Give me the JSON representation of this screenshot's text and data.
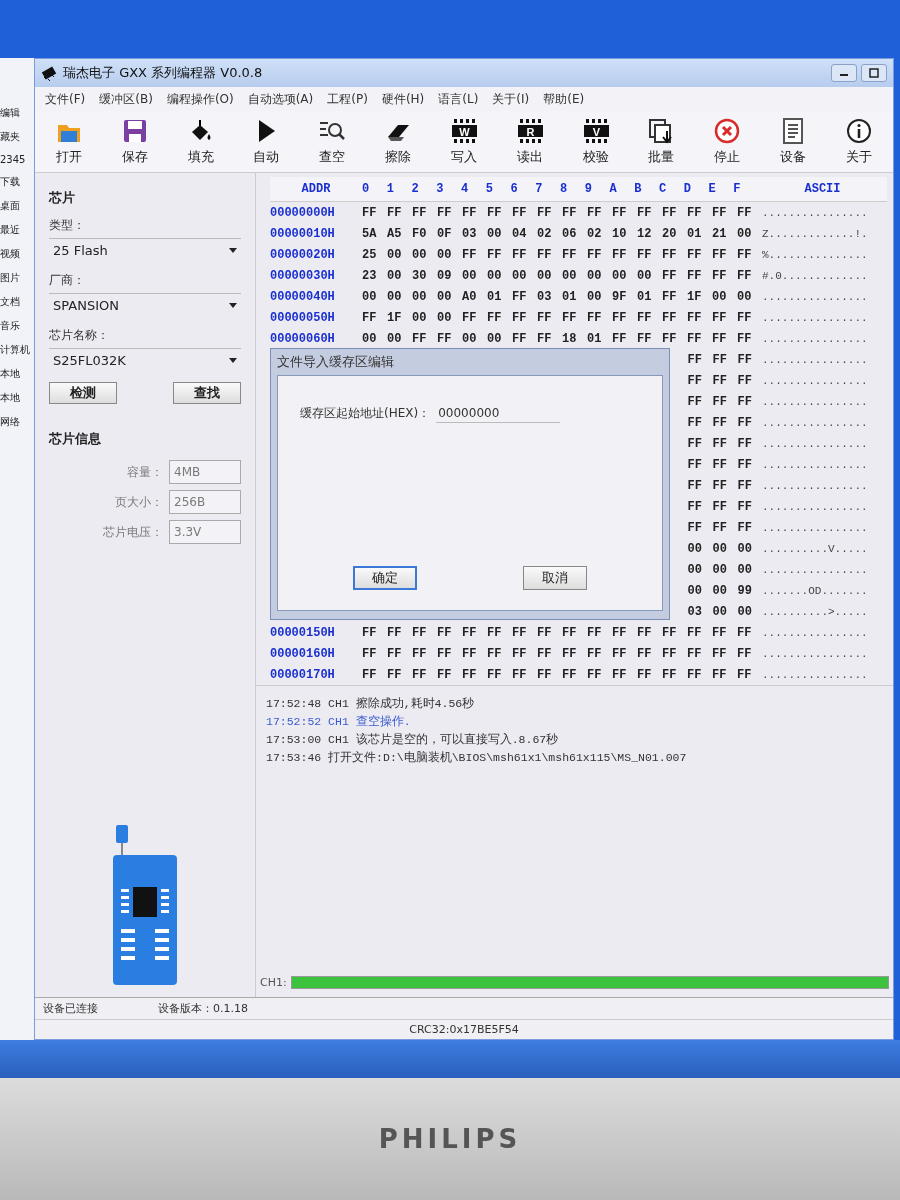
{
  "explorer": {
    "items": [
      "编辑",
      "藏夹",
      "2345",
      "下载",
      "桌面",
      "最近",
      "视频",
      "图片",
      "文档",
      "音乐",
      "计算机",
      "本地",
      "本地",
      "网络"
    ]
  },
  "window": {
    "title": "瑞杰电子 GXX 系列编程器 V0.0.8"
  },
  "menu": [
    "文件(F)",
    "缓冲区(B)",
    "编程操作(O)",
    "自动选项(A)",
    "工程(P)",
    "硬件(H)",
    "语言(L)",
    "关于(I)",
    "帮助(E)"
  ],
  "toolbar": [
    {
      "label": "打开",
      "kind": "folder"
    },
    {
      "label": "保存",
      "kind": "disk"
    },
    {
      "label": "填充",
      "kind": "bucket"
    },
    {
      "label": "自动",
      "kind": "play"
    },
    {
      "label": "查空",
      "kind": "search"
    },
    {
      "label": "擦除",
      "kind": "eraser"
    },
    {
      "label": "写入",
      "kind": "chip",
      "glyph": "W"
    },
    {
      "label": "读出",
      "kind": "chip",
      "glyph": "R"
    },
    {
      "label": "校验",
      "kind": "chip",
      "glyph": "V"
    },
    {
      "label": "批量",
      "kind": "copy"
    },
    {
      "label": "停止",
      "kind": "stop"
    },
    {
      "label": "设备",
      "kind": "document"
    },
    {
      "label": "关于",
      "kind": "info"
    }
  ],
  "chip_panel": {
    "heading": "芯片",
    "selects": [
      {
        "label": "类型：",
        "value": "25 Flash"
      },
      {
        "label": "厂商：",
        "value": "SPANSION"
      },
      {
        "label": "芯片名称：",
        "value": "S25FL032K"
      }
    ],
    "buttons": [
      "检测",
      "查找"
    ],
    "info_heading": "芯片信息",
    "info": [
      {
        "label": "容量：",
        "value": "4MB",
        "disabled": true
      },
      {
        "label": "页大小：",
        "value": "256B",
        "disabled": true
      },
      {
        "label": "芯片电压：",
        "value": "3.3V",
        "disabled": true
      }
    ]
  },
  "hex_view": {
    "addr_heading": "ADDR",
    "columns": [
      "0",
      "1",
      "2",
      "3",
      "4",
      "5",
      "6",
      "7",
      "8",
      "9",
      "A",
      "B",
      "C",
      "D",
      "E",
      "F"
    ],
    "ascii_heading": "ASCII",
    "rows": [
      {
        "address": "00000000H",
        "bytes": "FF FF FF FF FF FF FF FF FF FF FF FF FF FF FF FF",
        "ascii": "................"
      },
      {
        "address": "00000010H",
        "bytes": "5A A5 F0 0F 03 00 04 02 06 02 10 12 20 01 21 00",
        "ascii": "Z.............!."
      },
      {
        "address": "00000020H",
        "bytes": "25 00 00 00 FF FF FF FF FF FF FF FF FF FF FF FF",
        "ascii": "%..............."
      },
      {
        "address": "00000030H",
        "bytes": "23 00 30 09 00 00 00 00 00 00 00 00 FF FF FF FF",
        "ascii": "#.0............."
      },
      {
        "address": "00000040H",
        "bytes": "00 00 00 00 A0 01 FF 03 01 00 9F 01 FF 1F 00 00",
        "ascii": "................"
      },
      {
        "address": "00000050H",
        "bytes": "FF 1F 00 00 FF FF FF FF FF FF FF FF FF FF FF FF",
        "ascii": "................"
      },
      {
        "address": "00000060H",
        "bytes": "00 00 FF FF 00 00 FF FF 18 01 FF FF FF FF FF FF",
        "ascii": "................"
      },
      {
        "bytes": "FF FF FF",
        "ascii": "................"
      },
      {
        "bytes": "FF FF FF",
        "ascii": "................"
      },
      {
        "bytes": "FF FF FF",
        "ascii": "................"
      },
      {
        "bytes": "FF FF FF",
        "ascii": "................"
      },
      {
        "bytes": "FF FF FF",
        "ascii": "................"
      },
      {
        "bytes": "FF FF FF",
        "ascii": "................"
      },
      {
        "bytes": "FF FF FF",
        "ascii": "................"
      },
      {
        "bytes": "FF FF FF",
        "ascii": "................"
      },
      {
        "bytes": "FF FF FF",
        "ascii": "................"
      },
      {
        "bytes": "00 00 00",
        "ascii": "..........V....."
      },
      {
        "bytes": "00 00 00",
        "ascii": "................"
      },
      {
        "bytes": "00 00 99",
        "ascii": ".......OD......."
      },
      {
        "bytes": "03 00 00",
        "ascii": "..........>....."
      },
      {
        "address": "00000150H",
        "bytes": "FF FF FF FF FF FF FF FF FF FF FF FF FF FF FF FF",
        "ascii": "................"
      },
      {
        "address": "00000160H",
        "bytes": "FF FF FF FF FF FF FF FF FF FF FF FF FF FF FF FF",
        "ascii": "................"
      },
      {
        "address": "00000170H",
        "bytes": "FF FF FF FF FF FF FF FF FF FF FF FF FF FF FF FF",
        "ascii": "................"
      }
    ]
  },
  "dialog": {
    "title": "文件导入缓存区编辑",
    "label": "缓存区起始地址(HEX)：",
    "value": "00000000",
    "buttons": [
      {
        "label": "确定",
        "default": true
      },
      {
        "label": "取消",
        "default": false
      }
    ]
  },
  "log": [
    {
      "text": "17:52:48 CH1 擦除成功,耗时4.56秒",
      "color": "#333333"
    },
    {
      "text": "17:52:52 CH1 查空操作.",
      "color": "#3a5bd0"
    },
    {
      "text": "17:53:00 CH1 该芯片是空的，可以直接写入.8.67秒",
      "color": "#333333"
    },
    {
      "text": "17:53:46 打开文件:D:\\电脑装机\\BIOS\\msh61x1\\msh61x115\\MS_N01.007",
      "color": "#333333"
    }
  ],
  "progress": {
    "label": "CH1:",
    "level": 1
  },
  "status_bar": {
    "connection": "设备已连接",
    "version": "设备版本：0.1.18",
    "crc": "CRC32:0x17BE5F54"
  },
  "monitor": {
    "brand": "PHILIPS"
  }
}
